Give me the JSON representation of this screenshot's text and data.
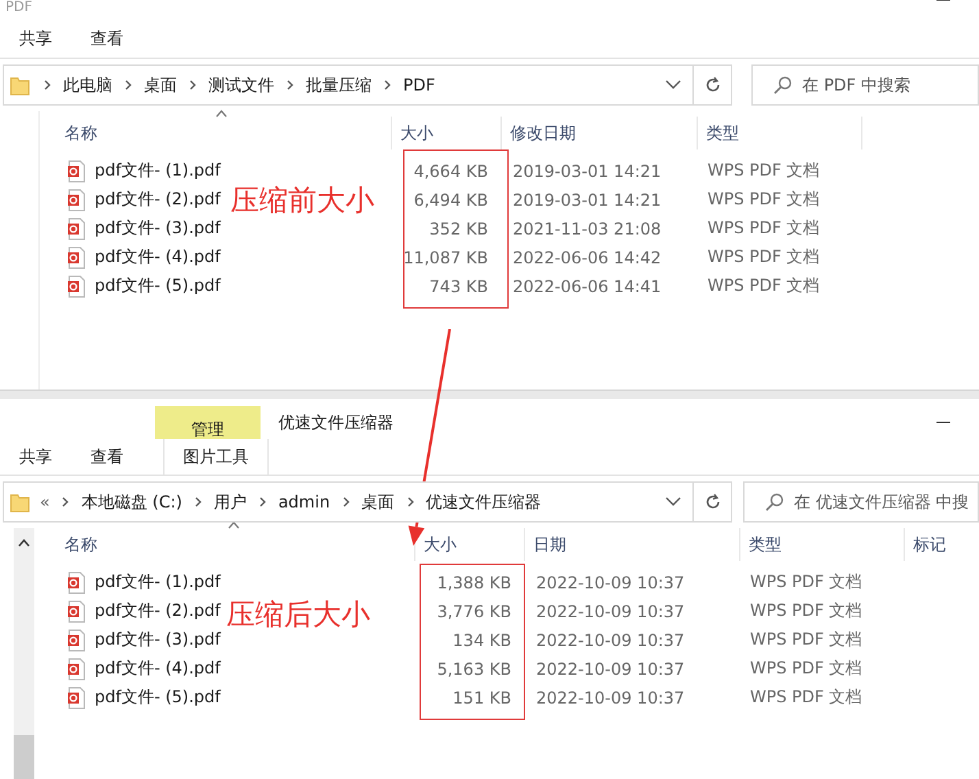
{
  "windows": [
    {
      "kind": "plain",
      "title": "PDF",
      "ribbon_tabs": [
        {
          "label": "共享",
          "kind": "standard"
        },
        {
          "label": "查看",
          "kind": "standard"
        }
      ],
      "breadcrumb": [
        "此电脑",
        "桌面",
        "测试文件",
        "批量压缩",
        "PDF"
      ],
      "search": {
        "placeholder": "在 PDF 中搜索"
      },
      "columns": [
        "名称",
        "大小",
        "修改日期",
        "类型"
      ],
      "rows": [
        {
          "name": "pdf文件- (1).pdf",
          "size": "4,664 KB",
          "date": "2019-03-01 14:21",
          "type": "WPS PDF 文档"
        },
        {
          "name": "pdf文件- (2).pdf",
          "size": "6,494 KB",
          "date": "2019-03-01 14:21",
          "type": "WPS PDF 文档"
        },
        {
          "name": "pdf文件- (3).pdf",
          "size": "352 KB",
          "date": "2021-11-03 21:08",
          "type": "WPS PDF 文档"
        },
        {
          "name": "pdf文件- (4).pdf",
          "size": "11,087 KB",
          "date": "2022-06-06 14:42",
          "type": "WPS PDF 文档"
        },
        {
          "name": "pdf文件- (5).pdf",
          "size": "743 KB",
          "date": "2022-06-06 14:41",
          "type": "WPS PDF 文档"
        }
      ],
      "annotation": "压缩前大小"
    },
    {
      "kind": "tools",
      "title": "优速文件压缩器",
      "context_group": "管理",
      "ribbon_tabs": [
        {
          "label": "共享",
          "kind": "standard"
        },
        {
          "label": "查看",
          "kind": "standard"
        },
        {
          "label": "图片工具",
          "kind": "contextual"
        }
      ],
      "breadcrumb_overflow": "«",
      "breadcrumb": [
        "本地磁盘 (C:)",
        "用户",
        "admin",
        "桌面",
        "优速文件压缩器"
      ],
      "search": {
        "placeholder": "在 优速文件压缩器 中搜"
      },
      "columns": [
        "名称",
        "大小",
        "日期",
        "类型",
        "标记"
      ],
      "rows": [
        {
          "name": "pdf文件- (1).pdf",
          "size": "1,388 KB",
          "date": "2022-10-09 10:37",
          "type": "WPS PDF 文档"
        },
        {
          "name": "pdf文件- (2).pdf",
          "size": "3,776 KB",
          "date": "2022-10-09 10:37",
          "type": "WPS PDF 文档"
        },
        {
          "name": "pdf文件- (3).pdf",
          "size": "134 KB",
          "date": "2022-10-09 10:37",
          "type": "WPS PDF 文档"
        },
        {
          "name": "pdf文件- (4).pdf",
          "size": "5,163 KB",
          "date": "2022-10-09 10:37",
          "type": "WPS PDF 文档"
        },
        {
          "name": "pdf文件- (5).pdf",
          "size": "151 KB",
          "date": "2022-10-09 10:37",
          "type": "WPS PDF 文档"
        }
      ],
      "annotation": "压缩后大小"
    }
  ]
}
